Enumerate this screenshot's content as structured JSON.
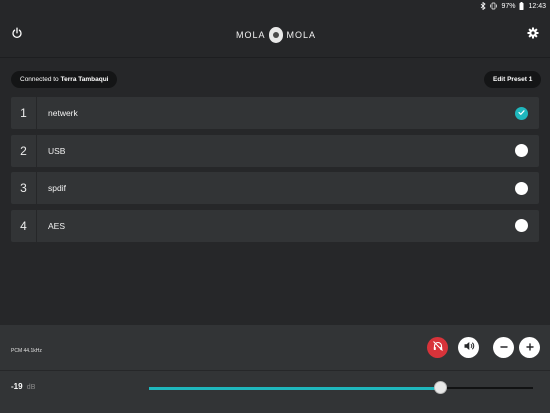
{
  "status_bar": {
    "battery": "97%",
    "time": "12:43",
    "icons": [
      "bluetooth-icon",
      "vibrate-icon",
      "battery-icon"
    ]
  },
  "app_bar": {
    "power_icon": "power-icon",
    "settings_icon": "gear-icon",
    "logo": {
      "left_word": "MOLA",
      "right_word": "MOLA"
    }
  },
  "connection": {
    "prefix": "Connected to",
    "device": "Terra Tambaqui"
  },
  "edit_preset_label": "Edit Preset 1",
  "sources": [
    {
      "number": "1",
      "label": "netwerk",
      "selected": true
    },
    {
      "number": "2",
      "label": "USB",
      "selected": false
    },
    {
      "number": "3",
      "label": "spdif",
      "selected": false
    },
    {
      "number": "4",
      "label": "AES",
      "selected": false
    }
  ],
  "player": {
    "format": "PCM 44.1kHz",
    "phase_icon": "phase-invert-icon",
    "mute_icon": "speaker-icon",
    "minus_icon": "minus-icon",
    "plus_icon": "plus-icon"
  },
  "volume": {
    "value": "-19",
    "unit": "dB",
    "slider_fraction": 0.76
  },
  "colors": {
    "accent": "#1fb7bd",
    "background": "#262729",
    "panel": "#323436",
    "phase_button": "#d8333a"
  }
}
